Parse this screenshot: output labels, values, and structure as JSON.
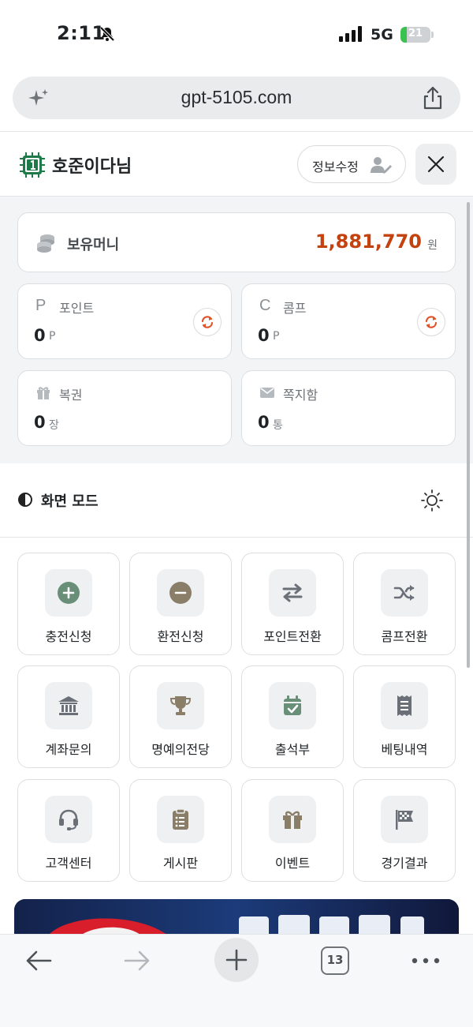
{
  "status": {
    "time": "2:11",
    "network": "5G",
    "battery_pct": 21,
    "battery_label": "21"
  },
  "browser": {
    "url": "gpt-5105.com",
    "tab_count": "13"
  },
  "header": {
    "username": "호준이다님",
    "edit_label": "정보수정"
  },
  "wallet": {
    "money_label": "보유머니",
    "money_value": "1,881,770",
    "money_unit": "원",
    "point": {
      "glyph": "P",
      "label": "포인트",
      "value": "0",
      "unit": "P"
    },
    "comp": {
      "glyph": "C",
      "label": "콤프",
      "value": "0",
      "unit": "P"
    },
    "ticket": {
      "label": "복권",
      "value": "0",
      "unit": "장"
    },
    "message": {
      "label": "쪽지함",
      "value": "0",
      "unit": "통"
    }
  },
  "screen_mode": {
    "label": "화면 모드"
  },
  "menu": [
    {
      "label": "충전신청",
      "icon": "plus-circle-icon"
    },
    {
      "label": "환전신청",
      "icon": "minus-circle-icon"
    },
    {
      "label": "포인트전환",
      "icon": "arrows-swap-icon"
    },
    {
      "label": "콤프전환",
      "icon": "shuffle-icon"
    },
    {
      "label": "계좌문의",
      "icon": "bank-icon"
    },
    {
      "label": "명예의전당",
      "icon": "trophy-icon"
    },
    {
      "label": "출석부",
      "icon": "calendar-check-icon"
    },
    {
      "label": "베팅내역",
      "icon": "receipt-icon"
    },
    {
      "label": "고객센터",
      "icon": "headset-icon"
    },
    {
      "label": "게시판",
      "icon": "clipboard-list-icon"
    },
    {
      "label": "이벤트",
      "icon": "gift-icon"
    },
    {
      "label": "경기결과",
      "icon": "checkered-flag-icon"
    }
  ],
  "colors": {
    "accent_money": "#c4420f",
    "refresh": "#e0542a",
    "plus_green": "#6a8f78",
    "minus_brown": "#8a7e68",
    "icon_gray": "#6b7078"
  }
}
